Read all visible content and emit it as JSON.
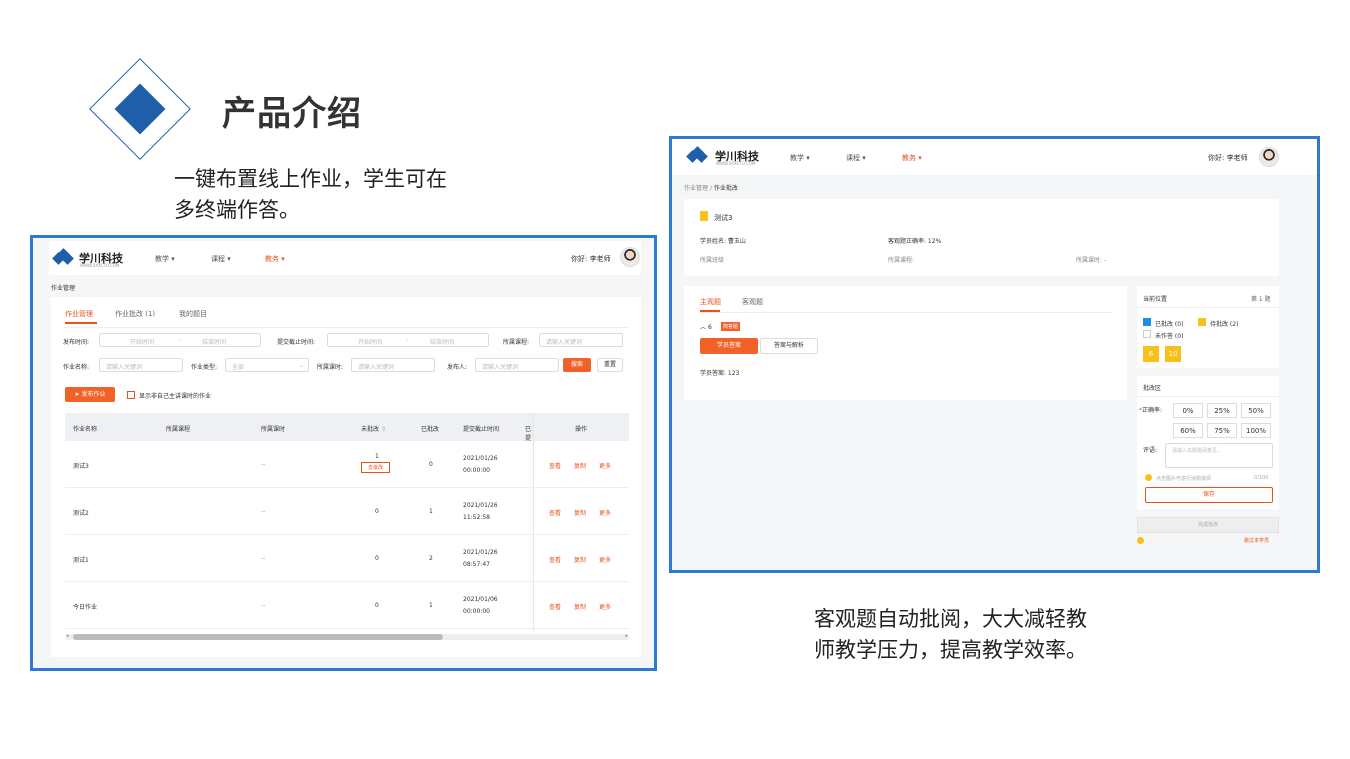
{
  "slide": {
    "title": "产品介绍",
    "caption_left": [
      "一键布置线上作业，学生可在",
      "多终端作答。"
    ],
    "caption_right": [
      "客观题自动批阅，大大减轻教",
      "师教学压力，提高教学效率。"
    ],
    "colors": {
      "accent_blue": "#1f5faa",
      "frame_blue": "#2f7ad1",
      "brand_orange": "#e8521e"
    }
  },
  "app": {
    "brand_name": "学川科技",
    "brand_sub": "WWW.XXXCTO.COM",
    "nav": [
      "教学",
      "课程",
      "教务"
    ],
    "active_nav": "教务",
    "greeting": "你好: 李老师"
  },
  "left": {
    "breadcrumb": "作业管理",
    "tabs": [
      "作业管理",
      "作业批改 (1)",
      "我的题目"
    ],
    "filters": {
      "publish_time_label": "发布时间:",
      "start_ph": "开始时间",
      "end_ph": "结束时间",
      "submit_deadline_label": "提交截止时间:",
      "course_label": "所属课程:",
      "course_ph": "请输入关键词",
      "name_label": "作业名称:",
      "name_ph": "请输入关键词",
      "type_label": "作业类型:",
      "type_value": "全部",
      "lesson_label": "所属课时:",
      "lesson_ph": "请输入关键词",
      "publisher_label": "发布人:",
      "publisher_ph": "请输入关键词",
      "search_btn": "搜索",
      "reset_btn": "重置"
    },
    "publish_btn": "发布作业",
    "show_only_label": "显示非自己主讲课时的作业",
    "columns": [
      "作业名称",
      "所属课程",
      "所属课时",
      "未批改",
      "已批改",
      "提交截止时间",
      "已提",
      "操作"
    ],
    "rows": [
      {
        "name": "测试3",
        "course": "",
        "lesson": "--",
        "ungraded": "1",
        "graded": "0",
        "date": "2021/01/26",
        "time": "00:00:00",
        "tag": "去批改"
      },
      {
        "name": "测试2",
        "course": "",
        "lesson": "--",
        "ungraded": "0",
        "graded": "1",
        "date": "2021/01/26",
        "time": "11:52:58",
        "tag": ""
      },
      {
        "name": "测试1",
        "course": "",
        "lesson": "--",
        "ungraded": "0",
        "graded": "2",
        "date": "2021/01/26",
        "time": "08:57:47",
        "tag": ""
      },
      {
        "name": "今日作业",
        "course": "",
        "lesson": "--",
        "ungraded": "0",
        "graded": "1",
        "date": "2021/01/06",
        "time": "00:00:00",
        "tag": ""
      }
    ],
    "actions": [
      "查看",
      "复制",
      "更多"
    ]
  },
  "right": {
    "breadcrumb": [
      "作业管理",
      "/",
      "作业批改"
    ],
    "hw_title": "测试3",
    "student_label": "学员姓名: 曹玉山",
    "accuracy_label": "客观题正确率: 12%",
    "class_label": "所属班级",
    "course_label": "所属课程:",
    "lesson_label": "所属课时: -",
    "tabs": [
      "主观题",
      "客观题"
    ],
    "question_no": "6",
    "question_badge": "简答题",
    "sub_tabs": [
      "学员答案",
      "答案与解析"
    ],
    "answer_text": "学员答案: 123",
    "position_title": "当前位置",
    "position_page": "第 1 题",
    "legend": [
      {
        "label": "已批改 (0)",
        "color": "#1e8fe0"
      },
      {
        "label": "待批改 (2)",
        "color": "#f8c01a"
      },
      {
        "label": "未作答 (0)",
        "color": "#ffffff"
      }
    ],
    "question_nums": [
      "6",
      "10"
    ],
    "grading_title": "批改区",
    "accuracy_field": "正确率:",
    "pct_options": [
      "0%",
      "25%",
      "50%",
      "60%",
      "75%",
      "100%"
    ],
    "comment_label": "评语:",
    "comment_ph": "请输入本题批阅意见...",
    "upload_hint": "点击图片可进行涂鸦批阅",
    "char_count": "0/100",
    "save_btn": "保存",
    "finish_btn": "完成批改",
    "skip_link": "跳过本学员"
  }
}
